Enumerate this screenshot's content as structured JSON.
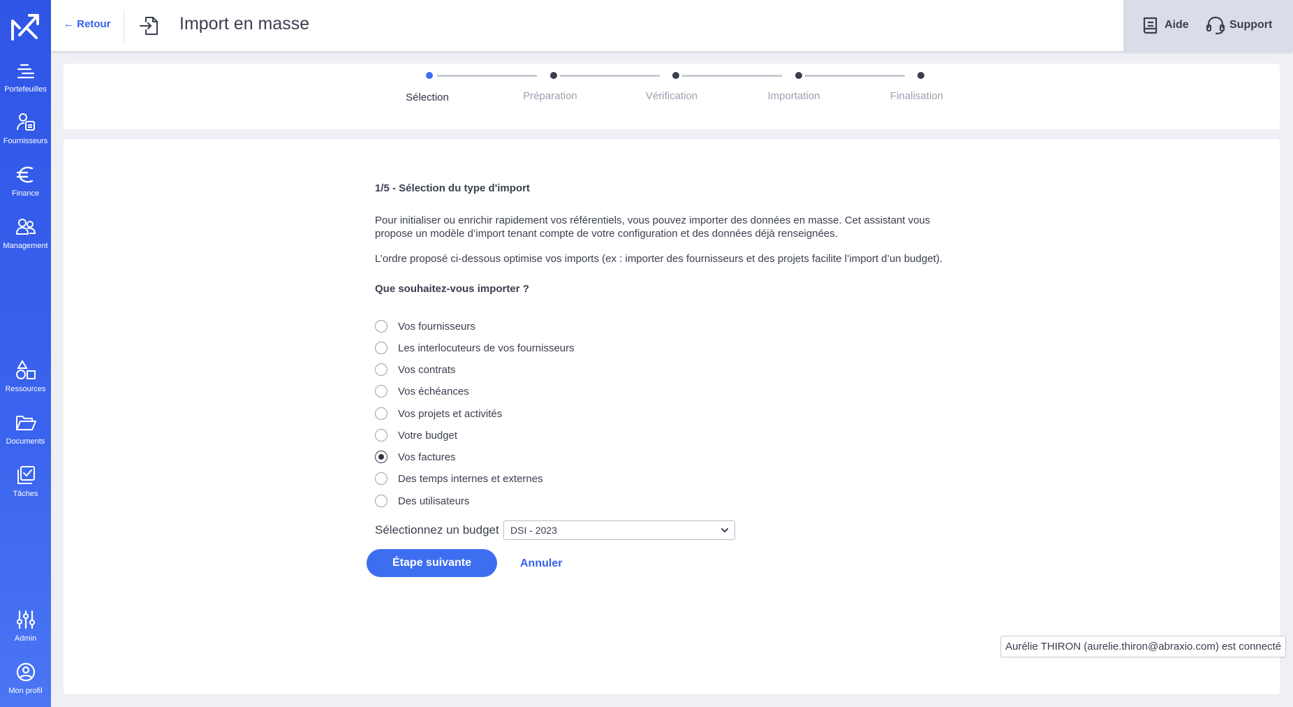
{
  "sidebar": {
    "items_top": [
      {
        "label": "Portefeuilles",
        "icon": "portfolio-icon"
      },
      {
        "label": "Fournisseurs",
        "icon": "suppliers-icon"
      },
      {
        "label": "Finance",
        "icon": "euro-icon"
      },
      {
        "label": "Management",
        "icon": "people-icon"
      }
    ],
    "items_middle": [
      {
        "label": "Ressources",
        "icon": "shapes-icon"
      },
      {
        "label": "Documents",
        "icon": "folder-icon"
      },
      {
        "label": "Tâches",
        "icon": "tasks-icon"
      }
    ],
    "items_bottom": [
      {
        "label": "Admin",
        "icon": "sliders-icon"
      },
      {
        "label": "Mon profil",
        "icon": "profile-icon"
      }
    ]
  },
  "header": {
    "back_label": "← Retour",
    "title": "Import en masse",
    "help_label": "Aide",
    "support_label": "Support"
  },
  "stepper": {
    "steps": [
      "Sélection",
      "Préparation",
      "Vérification",
      "Importation",
      "Finalisation"
    ],
    "active_index": 0
  },
  "main": {
    "section_title": "1/5 - Sélection du type d'import",
    "intro_line1": "Pour initialiser ou enrichir rapidement vos référentiels, vous pouvez importer des données en masse. Cet assistant vous",
    "intro_line2": "propose un modèle d’import tenant compte de votre configuration et des données déjà renseignées.",
    "order_note": "L’ordre proposé ci-dessous optimise vos imports (ex : importer des fournisseurs et des projets facilite l’import d’un budget).",
    "question": "Que souhaitez-vous importer ?",
    "options": [
      {
        "label": "Vos fournisseurs",
        "checked": false
      },
      {
        "label": "Les interlocuteurs de vos fournisseurs",
        "checked": false
      },
      {
        "label": "Vos contrats",
        "checked": false
      },
      {
        "label": "Vos échéances",
        "checked": false
      },
      {
        "label": "Vos projets et activités",
        "checked": false
      },
      {
        "label": "Votre budget",
        "checked": false
      },
      {
        "label": "Vos factures",
        "checked": true
      },
      {
        "label": "Des temps internes et externes",
        "checked": false
      },
      {
        "label": "Des utilisateurs",
        "checked": false
      }
    ],
    "budget_label": "Sélectionnez un budget",
    "budget_value": "DSI - 2023",
    "next_label": "Étape suivante",
    "cancel_label": "Annuler"
  },
  "status": {
    "connected_text": "Aurélie THIRON (aurelie.thiron@abraxio.com) est connecté"
  },
  "colors": {
    "accent": "#3e6ef0",
    "sidebar": "#3a63ee",
    "text": "#3a3f4e"
  }
}
